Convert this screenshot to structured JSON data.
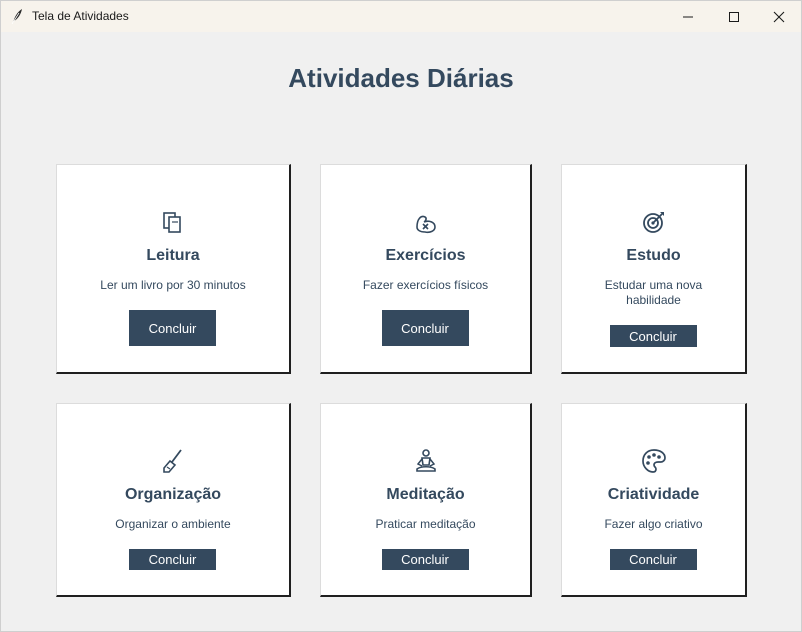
{
  "window": {
    "title": "Tela de Atividades"
  },
  "heading": "Atividades Diárias",
  "activities": [
    {
      "icon": "books-icon",
      "title": "Leitura",
      "description": "Ler um livro por 30 minutos",
      "button": "Concluir"
    },
    {
      "icon": "exercise-icon",
      "title": "Exercícios",
      "description": "Fazer exercícios físicos",
      "button": "Concluir"
    },
    {
      "icon": "target-icon",
      "title": "Estudo",
      "description": "Estudar uma nova habilidade",
      "button": "Concluir"
    },
    {
      "icon": "broom-icon",
      "title": "Organização",
      "description": "Organizar o ambiente",
      "button": "Concluir"
    },
    {
      "icon": "meditation-icon",
      "title": "Meditação",
      "description": "Praticar meditação",
      "button": "Concluir"
    },
    {
      "icon": "palette-icon",
      "title": "Criatividade",
      "description": "Fazer algo criativo",
      "button": "Concluir"
    }
  ],
  "colors": {
    "accent": "#34495e",
    "background": "#f0f0f0",
    "card": "#ffffff"
  }
}
